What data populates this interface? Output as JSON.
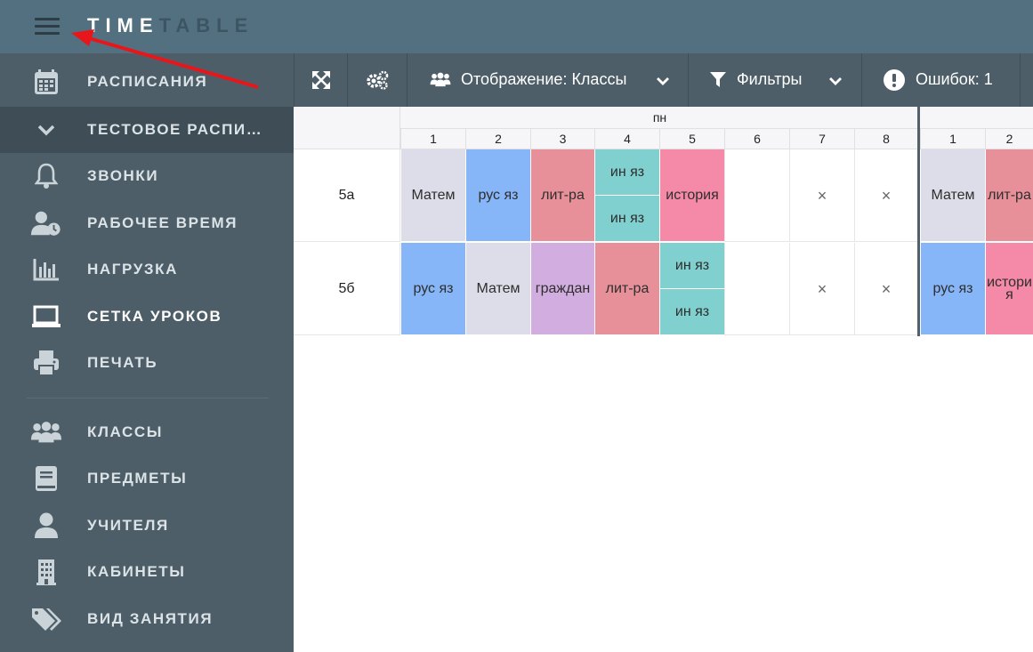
{
  "header": {
    "logo_bold": "TIME",
    "logo_light": "TABLE"
  },
  "sidebar": {
    "items": [
      {
        "key": "schedules",
        "label": "РАСПИСАНИЯ",
        "icon": "calendar-icon"
      },
      {
        "key": "test-schedule",
        "label": "ТЕСТОВОЕ РАСПИСАНИЕ",
        "icon": "chevron-down-icon"
      },
      {
        "key": "bells",
        "label": "ЗВОНКИ",
        "icon": "bell-icon"
      },
      {
        "key": "work-time",
        "label": "РАБОЧЕЕ ВРЕМЯ",
        "icon": "user-clock-icon"
      },
      {
        "key": "load",
        "label": "НАГРУЗКА",
        "icon": "bar-chart-icon"
      },
      {
        "key": "lesson-grid",
        "label": "СЕТКА УРОКОВ",
        "icon": "monitor-icon"
      },
      {
        "key": "print",
        "label": "ПЕЧАТЬ",
        "icon": "printer-icon"
      },
      {
        "key": "classes",
        "label": "КЛАССЫ",
        "icon": "users-icon"
      },
      {
        "key": "subjects",
        "label": "ПРЕДМЕТЫ",
        "icon": "book-icon"
      },
      {
        "key": "teachers",
        "label": "УЧИТЕЛЯ",
        "icon": "user-icon"
      },
      {
        "key": "rooms",
        "label": "КАБИНЕТЫ",
        "icon": "building-icon"
      },
      {
        "key": "activity-type",
        "label": "ВИД ЗАНЯТИЯ",
        "icon": "tags-icon"
      }
    ]
  },
  "toolbar": {
    "display_label": "Отображение: Классы",
    "filters_label": "Фильтры",
    "errors_label": "Ошибок: 1"
  },
  "grid": {
    "day1": "пн",
    "day1_periods": [
      "1",
      "2",
      "3",
      "4",
      "5",
      "6",
      "7",
      "8"
    ],
    "day2_periods": [
      "1",
      "2"
    ],
    "rows": [
      {
        "label": "5а",
        "cells": [
          {
            "text": "Матем",
            "color": "#dcdde8"
          },
          {
            "text": "рус яз",
            "color": "#86b6f7"
          },
          {
            "text": "лит-ра",
            "color": "#e8909a"
          },
          {
            "split": [
              "ин яз",
              "ин яз"
            ],
            "color": "#80d0cf"
          },
          {
            "text": "история",
            "color": "#f58aa8"
          },
          {
            "text": "",
            "color": "#ffffff"
          },
          {
            "text": "×",
            "color": "#ffffff"
          },
          {
            "text": "×",
            "color": "#ffffff"
          },
          {
            "text": "Матем",
            "color": "#dcdde8"
          },
          {
            "text": "лит-ра",
            "color": "#e8909a"
          }
        ]
      },
      {
        "label": "5б",
        "cells": [
          {
            "text": "рус яз",
            "color": "#86b6f7"
          },
          {
            "text": "Матем",
            "color": "#dcdde8"
          },
          {
            "text": "граждан",
            "color": "#d2aee0"
          },
          {
            "text": "лит-ра",
            "color": "#e8909a"
          },
          {
            "split": [
              "ин яз",
              "ин яз"
            ],
            "color": "#80d0cf"
          },
          {
            "text": "",
            "color": "#ffffff"
          },
          {
            "text": "×",
            "color": "#ffffff"
          },
          {
            "text": "×",
            "color": "#ffffff"
          },
          {
            "text": "рус яз",
            "color": "#86b6f7"
          },
          {
            "text": "история",
            "color": "#f58aa8"
          }
        ]
      }
    ]
  }
}
